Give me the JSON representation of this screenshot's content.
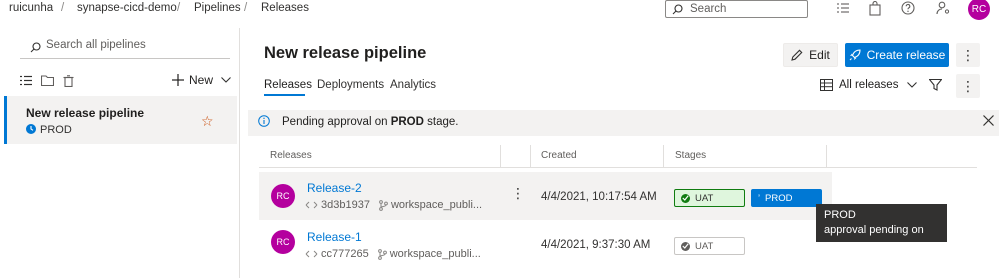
{
  "breadcrumb": {
    "org": "ruicunha",
    "project": "synapse-cicd-demo",
    "section": "Pipelines",
    "page": "Releases",
    "separator": "/"
  },
  "topbar": {
    "search_placeholder": "Search",
    "user_initials": "RC"
  },
  "sidebar": {
    "search_placeholder": "Search all pipelines",
    "new_label": "New",
    "pipeline": {
      "name": "New release pipeline",
      "stage": "PROD"
    }
  },
  "main": {
    "title": "New release pipeline",
    "edit_label": "Edit",
    "create_label": "Create release",
    "tabs": [
      {
        "label": "Releases",
        "active": true
      },
      {
        "label": "Deployments",
        "active": false
      },
      {
        "label": "Analytics",
        "active": false
      }
    ],
    "filter_label": "All releases"
  },
  "infobar": {
    "pre": "Pending approval on ",
    "stage": "PROD",
    "post": " stage."
  },
  "table": {
    "headers": {
      "releases": "Releases",
      "created": "Created",
      "stages": "Stages"
    },
    "rows": [
      {
        "initials": "RC",
        "name": "Release-2",
        "commit": "3d3b1937",
        "branch": "workspace_publi...",
        "created": "4/4/2021, 10:17:54 AM",
        "stages": [
          {
            "name": "UAT",
            "status": "succeeded"
          },
          {
            "name": "PROD",
            "status": "pending"
          }
        ]
      },
      {
        "initials": "RC",
        "name": "Release-1",
        "commit": "cc777265",
        "branch": "workspace_publi...",
        "created": "4/4/2021, 9:37:30 AM",
        "stages": [
          {
            "name": "UAT",
            "status": "succeeded"
          }
        ]
      }
    ]
  },
  "tooltip": {
    "line1": "PROD",
    "line2": "approval pending on you"
  },
  "colors": {
    "accent": "#0078d4",
    "avatar": "#b4009e",
    "success": "#107c10",
    "favorite_star": "#ca5010"
  }
}
